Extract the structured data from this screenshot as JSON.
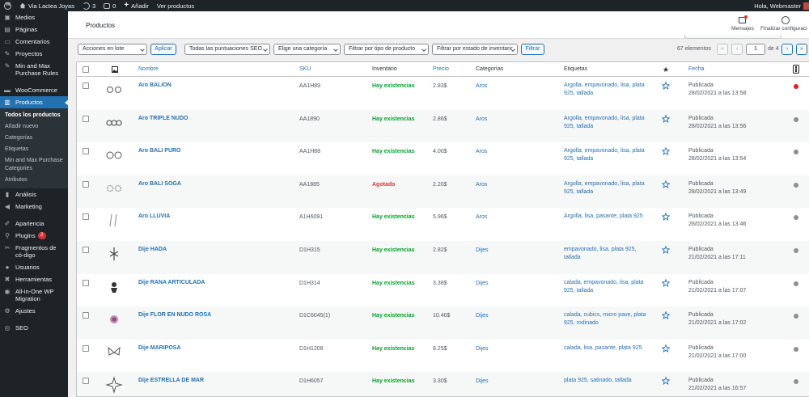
{
  "adminbar": {
    "site_name": "Via Lactea Joyas",
    "updates_count": "3",
    "comments_count": "0",
    "new_label": "Añadir",
    "view_products": "Ver productos",
    "greeting": "Hola, Webmaster"
  },
  "sidebar": {
    "items": [
      {
        "label": "Medios",
        "icon": "media-icon"
      },
      {
        "label": "Páginas",
        "icon": "pages-icon"
      },
      {
        "label": "Comentarios",
        "icon": "comments-icon"
      },
      {
        "label": "Proyectos",
        "icon": "pin-icon"
      },
      {
        "label": "Min and Max Purchase Rules",
        "icon": "pin-icon"
      },
      {
        "label": "WooCommerce",
        "icon": "woocommerce-icon"
      },
      {
        "label": "Productos",
        "icon": "products-icon"
      },
      {
        "label": "Análisis",
        "icon": "analytics-icon"
      },
      {
        "label": "Marketing",
        "icon": "megaphone-icon"
      },
      {
        "label": "Apariencia",
        "icon": "brush-icon"
      },
      {
        "label": "Plugins",
        "icon": "plugin-icon",
        "badge": "2"
      },
      {
        "label": "Fragmentos de có-digo",
        "icon": "code-icon"
      },
      {
        "label": "Usuarios",
        "icon": "users-icon"
      },
      {
        "label": "Herramientas",
        "icon": "tools-icon"
      },
      {
        "label": "All-in-One WP Migration",
        "icon": "migration-icon"
      },
      {
        "label": "Ajustes",
        "icon": "settings-icon"
      },
      {
        "label": "SEO",
        "icon": "seo-icon"
      }
    ],
    "submenu": [
      "Todos los productos",
      "Añadir nuevo",
      "Categorías",
      "Etiquetas",
      "Min and Max Purchase Categories",
      "Atributos"
    ]
  },
  "header": {
    "title": "Productos",
    "messages": "Mensajes",
    "finish_setup": "Finalizar configuraci"
  },
  "toolbar": {
    "bulk_actions": "Acciones en lote",
    "apply": "Aplicar",
    "ratings": "Todas las puntuaciones SEO",
    "category": "Elige una categoría",
    "product_type": "Filtrar por tipo de producto",
    "stock_status": "Filtrar por estado de inventario",
    "filter": "Filtrar",
    "count": "67 elementos",
    "first": "«",
    "prev": "‹",
    "current_page": "1",
    "of_pages": "de 4",
    "next": "›",
    "last": "»"
  },
  "table": {
    "columns": {
      "name": "Nombre",
      "sku": "SKU",
      "inventory": "Inventario",
      "price": "Precio",
      "categories": "Categorías",
      "tags": "Etiquetas",
      "date": "Fecha"
    },
    "rows": [
      {
        "name": "Aro BALION",
        "sku": "AA1H89",
        "stock": "Hay existencias",
        "in_stock": true,
        "price": "2.83$",
        "category": "Aros",
        "tags": "Argolla, empavonado, lisa, plata 925, tallada",
        "status": "Publicada",
        "date": "28/02/2021 a las 13:58",
        "dot": "#e01e1e"
      },
      {
        "name": "Aro TRIPLE NUDO",
        "sku": "AA1890",
        "stock": "Hay existencias",
        "in_stock": true,
        "price": "2.86$",
        "category": "Aros",
        "tags": "Argolla, empavonado, lisa, plata 925, tallada",
        "status": "Publicada",
        "date": "28/02/2021 a las 13:56",
        "dot": "#8c8f94"
      },
      {
        "name": "Aro BALI PURO",
        "sku": "AA1H88",
        "stock": "Hay existencias",
        "in_stock": true,
        "price": "4.00$",
        "category": "Aros",
        "tags": "Argolla, empavonado, lisa, plata 925, tallada",
        "status": "Publicada",
        "date": "28/02/2021 a las 13:54",
        "dot": "#8c8f94"
      },
      {
        "name": "Aro BALI SOGA",
        "sku": "AA1885",
        "stock": "Agotado",
        "in_stock": false,
        "price": "2.20$",
        "category": "Aros",
        "tags": "Argolla, empavonado, lisa, plata 925, tallada",
        "status": "Publicada",
        "date": "28/02/2021 a las 13:49",
        "dot": "#8c8f94"
      },
      {
        "name": "Aro LLUVIA",
        "sku": "A1H6091",
        "stock": "Hay existencias",
        "in_stock": true,
        "price": "5.96$",
        "category": "Aros",
        "tags": "Argolla, lisa, pasante, plata 925",
        "status": "Publicada",
        "date": "28/02/2021 a las 13:46",
        "dot": "#8c8f94"
      },
      {
        "name": "Dije HADA",
        "sku": "D1H315",
        "stock": "Hay existencias",
        "in_stock": true,
        "price": "2.82$",
        "category": "Dijes",
        "tags": "empavonado, lisa, plata 925, tallada",
        "status": "Publicada",
        "date": "21/02/2021 a las 17:11",
        "dot": "#8c8f94"
      },
      {
        "name": "Dije RANA ARTICULADA",
        "sku": "D1H314",
        "stock": "Hay existencias",
        "in_stock": true,
        "price": "3.38$",
        "category": "Dijes",
        "tags": "calada, empavonado, lisa, plata 925, tallada",
        "status": "Publicada",
        "date": "21/02/2021 a las 17:07",
        "dot": "#8c8f94"
      },
      {
        "name": "Dije FLOR EN NUDO ROSA",
        "sku": "D1C6045(1)",
        "stock": "Hay existencias",
        "in_stock": true,
        "price": "10.40$",
        "category": "Dijes",
        "tags": "calada, cubics, micro pave, plata 925, rodinado",
        "status": "Publicada",
        "date": "21/02/2021 a las 17:02",
        "dot": "#8c8f94"
      },
      {
        "name": "Dije MARIPOSA",
        "sku": "D1H1208",
        "stock": "Hay existencias",
        "in_stock": true,
        "price": "8.25$",
        "category": "Dijes",
        "tags": "calada, lisa, pasante, plata 925",
        "status": "Publicada",
        "date": "21/02/2021 a las 17:00",
        "dot": "#8c8f94"
      },
      {
        "name": "Dije ESTRELLA DE MAR",
        "sku": "D1H6057",
        "stock": "Hay existencias",
        "in_stock": true,
        "price": "3.30$",
        "category": "Dijes",
        "tags": "plata 925, satinado, tallada",
        "status": "Publicada",
        "date": "21/02/2021 a las 16:57",
        "dot": "#8c8f94"
      }
    ]
  },
  "colors": {
    "accent": "#2271b1",
    "instock": "#00a32a",
    "outstock": "#d63638",
    "sidebar_bg": "#1d2327"
  }
}
